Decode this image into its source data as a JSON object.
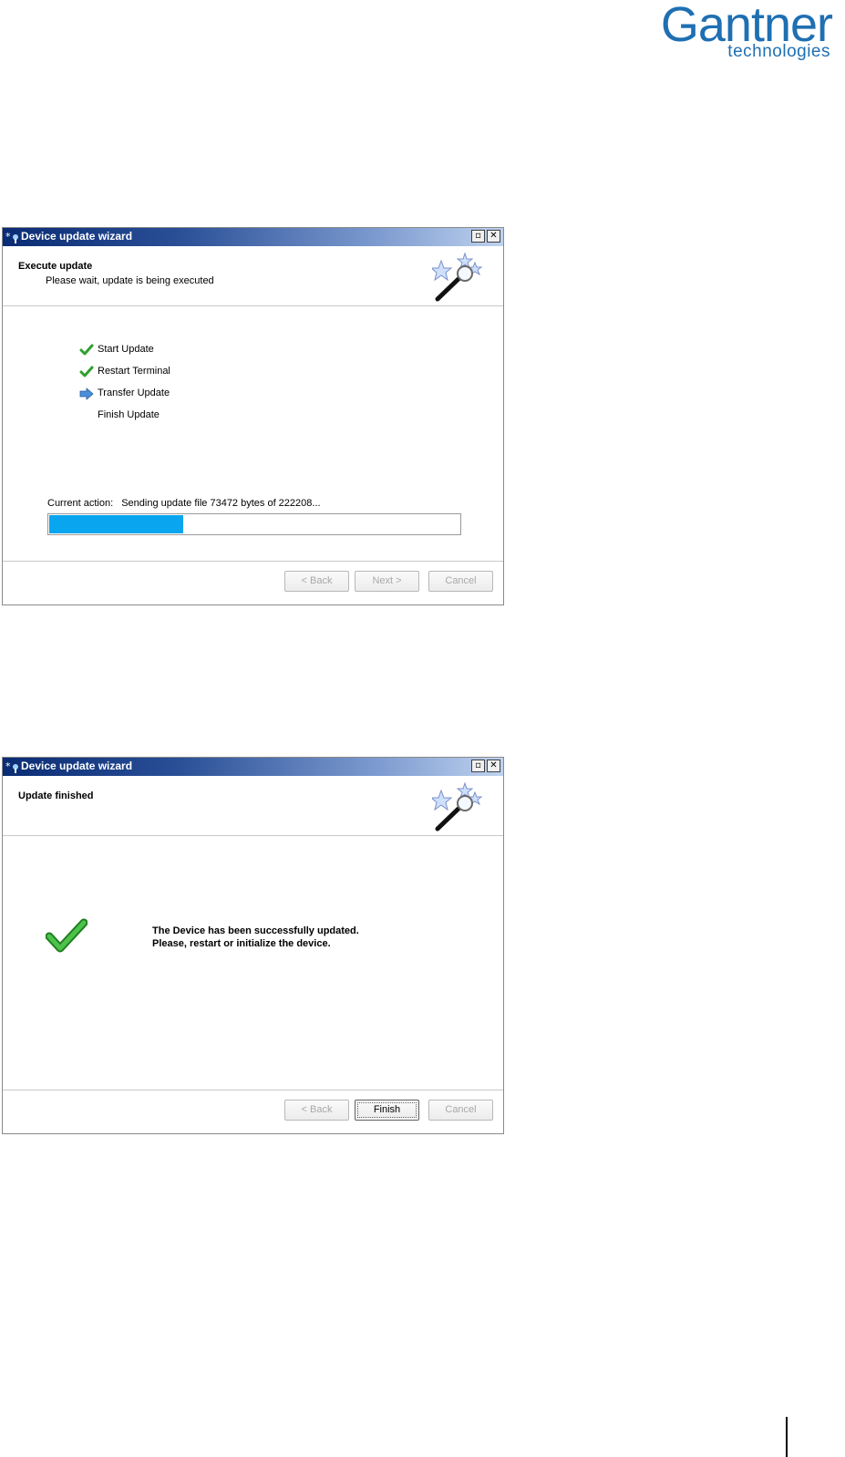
{
  "brand": {
    "name": "Gantner",
    "tagline": "technologies",
    "color": "#1f6fb2"
  },
  "window1": {
    "title": "Device update wizard",
    "header_title": "Execute update",
    "header_subtitle": "Please wait, update is being executed",
    "steps": [
      {
        "label": "Start Update",
        "status": "done",
        "icon": "checkmark-icon"
      },
      {
        "label": "Restart Terminal",
        "status": "done",
        "icon": "checkmark-icon"
      },
      {
        "label": "Transfer Update",
        "status": "current",
        "icon": "arrow-right-icon"
      },
      {
        "label": "Finish Update",
        "status": "pending",
        "icon": ""
      }
    ],
    "current_action_label": "Current action:",
    "current_action_text": "Sending update file 73472 bytes of 222208...",
    "progress_fraction": 0.33,
    "buttons": {
      "back": "< Back",
      "next": "Next >",
      "cancel": "Cancel"
    }
  },
  "window2": {
    "title": "Device update wizard",
    "header_title": "Update finished",
    "message_line1": "The Device has been successfully updated.",
    "message_line2": "Please, restart or initialize the device.",
    "buttons": {
      "back": "< Back",
      "finish": "Finish",
      "cancel": "Cancel"
    }
  },
  "colors": {
    "progress_fill": "#0aa5ef",
    "titlebar_start": "#0a2c74",
    "titlebar_end": "#bfd2ee",
    "check_green": "#2ea02e"
  }
}
